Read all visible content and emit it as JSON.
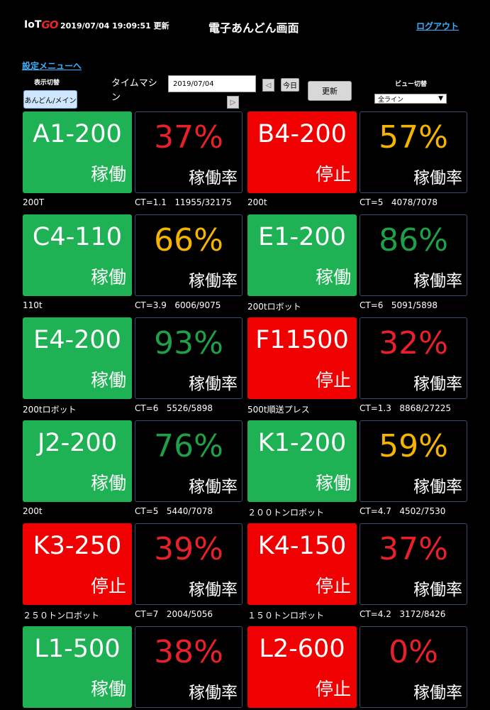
{
  "header": {
    "logo_text": "IoT",
    "logo_accent": "GO",
    "timestamp": "2019/07/04 19:09:51 更新",
    "title": "電子あんどん画面",
    "logout": "ログアウト"
  },
  "settings_link": "設定メニューへ",
  "controls": {
    "display_label": "表示切替",
    "display_button": "あんどん/メイン",
    "timemachine_label": "タイムマシン",
    "date_value": "2019/07/04",
    "prev_symbol": "◁",
    "next_symbol": "▷",
    "today_label": "今日",
    "update_label": "更新",
    "view_label": "ビュー切替",
    "view_selected": "全ライン",
    "view_arrow": "▼"
  },
  "colors": {
    "running": "#1fb254",
    "stopped": "#f00000",
    "pct_red": "#e8202a",
    "pct_orange": "#f5b400",
    "pct_green": "#1fa048"
  },
  "machines": [
    {
      "name": "A1-200",
      "state": "稼働",
      "status": "running",
      "rate_pct": "37%",
      "pct_color": "red",
      "rate_label": "稼働率",
      "model": "200T",
      "ct": "CT=1.1",
      "count": "11955/32175"
    },
    {
      "name": "B4-200",
      "state": "停止",
      "status": "stopped",
      "rate_pct": "57%",
      "pct_color": "orange",
      "rate_label": "稼働率",
      "model": "200t",
      "ct": "CT=5",
      "count": "4078/7078"
    },
    {
      "name": "C4-110",
      "state": "稼働",
      "status": "running",
      "rate_pct": "66%",
      "pct_color": "orange",
      "rate_label": "稼働率",
      "model": "110t",
      "ct": "CT=3.9",
      "count": "6006/9075"
    },
    {
      "name": "E1-200",
      "state": "稼働",
      "status": "running",
      "rate_pct": "86%",
      "pct_color": "green",
      "rate_label": "稼働率",
      "model": "200tロボット",
      "ct": "CT=6",
      "count": "5091/5898"
    },
    {
      "name": "E4-200",
      "state": "稼働",
      "status": "running",
      "rate_pct": "93%",
      "pct_color": "green",
      "rate_label": "稼働率",
      "model": "200tロボット",
      "ct": "CT=6",
      "count": "5526/5898"
    },
    {
      "name": "F11500",
      "state": "停止",
      "status": "stopped",
      "rate_pct": "32%",
      "pct_color": "red",
      "rate_label": "稼働率",
      "model": "500t順送プレス",
      "ct": "CT=1.3",
      "count": "8868/27225"
    },
    {
      "name": "J2-200",
      "state": "稼働",
      "status": "running",
      "rate_pct": "76%",
      "pct_color": "green",
      "rate_label": "稼働率",
      "model": "200t",
      "ct": "CT=5",
      "count": "5440/7078"
    },
    {
      "name": "K1-200",
      "state": "稼働",
      "status": "running",
      "rate_pct": "59%",
      "pct_color": "orange",
      "rate_label": "稼働率",
      "model": "２００トンロボット",
      "ct": "CT=4.7",
      "count": "4502/7530"
    },
    {
      "name": "K3-250",
      "state": "停止",
      "status": "stopped",
      "rate_pct": "39%",
      "pct_color": "red",
      "rate_label": "稼働率",
      "model": "２５０トンロボット",
      "ct": "CT=7",
      "count": "2004/5056"
    },
    {
      "name": "K4-150",
      "state": "停止",
      "status": "stopped",
      "rate_pct": "37%",
      "pct_color": "red",
      "rate_label": "稼働率",
      "model": "１５０トンロボット",
      "ct": "CT=4.2",
      "count": "3172/8426"
    },
    {
      "name": "L1-500",
      "state": "稼働",
      "status": "running",
      "rate_pct": "38%",
      "pct_color": "red",
      "rate_label": "稼働率",
      "model": "",
      "ct": "",
      "count": ""
    },
    {
      "name": "L2-600",
      "state": "停止",
      "status": "stopped",
      "rate_pct": "0%",
      "pct_color": "red",
      "rate_label": "稼働率",
      "model": "",
      "ct": "",
      "count": ""
    }
  ]
}
